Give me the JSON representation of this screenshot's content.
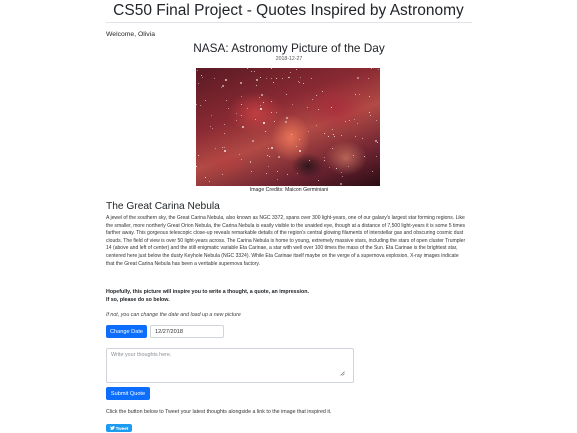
{
  "site": {
    "title": "CS50 Final Project - Quotes Inspired by Astronomy"
  },
  "user": {
    "welcome": "Welcome, Olivia"
  },
  "apod": {
    "heading": "NASA: Astronomy Picture of the Day",
    "date": "2018-12-27",
    "image_alt": "The Great Carina Nebula",
    "credit": "Image Credits: Maicon Germiniani",
    "title": "The Great Carina Nebula",
    "explanation": "A jewel of the southern sky, the Great Carina Nebula, also known as NGC 3372, spans over 300 light-years, one of our galaxy's largest star forming regions. Like the smaller, more northerly Great Orion Nebula, the Carina Nebula is easily visible to the unaided eye, though at a distance of 7,500 light-years it is some 5 times farther away. This gorgeous telescopic close-up reveals remarkable details of the region's central glowing filaments of interstellar gas and obscuring cosmic dust clouds. The field of view is over 50 light-years across. The Carina Nebula is home to young, extremely massive stars, including the stars of open cluster Trumpler 14 (above and left of center) and the still enigmatic variable Eta Carinae, a star with well over 100 times the mass of the Sun. Eta Carinae is the brightest star, centered here just below the dusty Keyhole Nebula (NGC 3324). While Eta Carinae itself maybe on the verge of a supernova explosion, X-ray images indicate that the Great Carina Nebula has been a veritable supernova factory."
  },
  "prompt": {
    "line1": "Hopefully, this picture will inspire you to write a thought, a quote, an impression.",
    "line2": "If so, please do so below."
  },
  "date_form": {
    "note": "If not, you can change the date and load up a new picture",
    "button_label": "Change Date",
    "date_value": "12/27/2018"
  },
  "thoughts_form": {
    "placeholder": "Write your thoughts here.",
    "submit_label": "Submit Quote"
  },
  "tweet": {
    "note": "Click the button below to Tweet your latest thoughts alongside a link to the image that inspired it.",
    "button_label": "Tweet"
  },
  "colors": {
    "primary": "#0d6efd",
    "twitter": "#1d9bf0"
  },
  "icons": {
    "tweet": "twitter-bird-icon"
  }
}
